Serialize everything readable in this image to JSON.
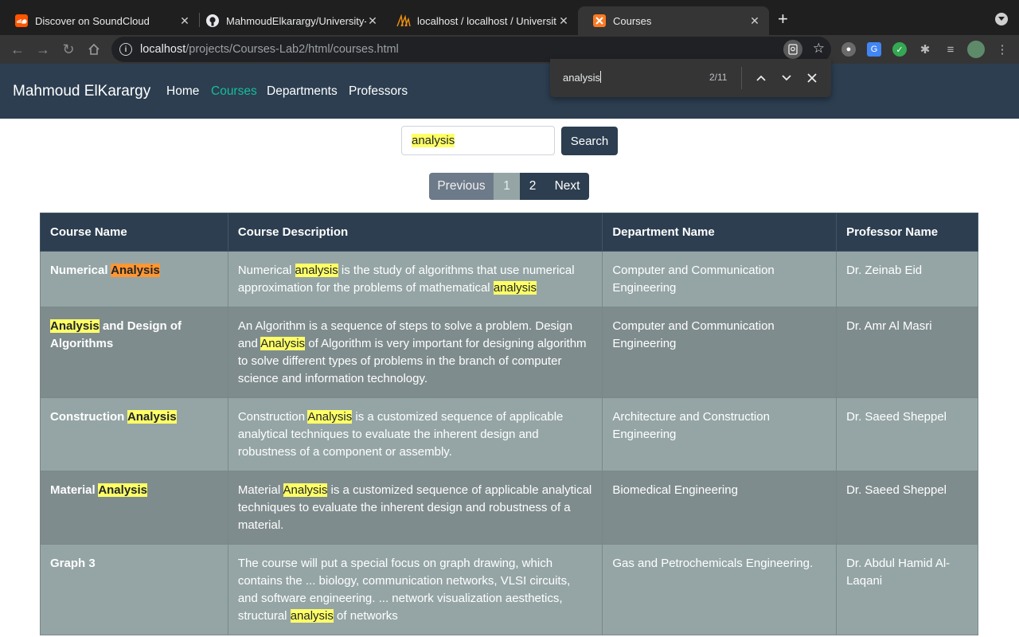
{
  "browser": {
    "tabs": [
      {
        "title": "Discover on SoundCloud",
        "icon": "soundcloud-icon"
      },
      {
        "title": "MahmoudElkarargy/University-",
        "icon": "github-icon"
      },
      {
        "title": "localhost / localhost / Universit",
        "icon": "phpmyadmin-icon"
      },
      {
        "title": "Courses",
        "icon": "xampp-icon"
      }
    ],
    "url_host": "localhost",
    "url_path": "/projects/Courses-Lab2/html/courses.html",
    "find": {
      "query": "analysis",
      "count": "2/11"
    }
  },
  "navbar": {
    "brand": "Mahmoud ElKarargy",
    "links": [
      "Home",
      "Courses",
      "Departments",
      "Professors"
    ],
    "active_color": "#18bc9c"
  },
  "search": {
    "value": "analysis",
    "button": "Search"
  },
  "pagination": [
    "Previous",
    "1",
    "2",
    "Next"
  ],
  "table": {
    "headers": [
      "Course Name",
      "Course Description",
      "Department Name",
      "Professor Name"
    ],
    "rows": [
      {
        "name": [
          "Numerical ",
          "Analysis",
          ""
        ],
        "desc": [
          "Numerical ",
          "analysis",
          " is the study of algorithms that use numerical approximation for the problems of mathematical ",
          "analysis",
          ""
        ],
        "dept": "Computer and Communication Engineering",
        "prof": "Dr. Zeinab Eid"
      },
      {
        "name": [
          "",
          "Analysis",
          " and Design of Algorithms"
        ],
        "desc": [
          "An Algorithm is a sequence of steps to solve a problem. Design and ",
          "Analysis",
          " of Algorithm is very important for designing algorithm to solve different types of problems in the branch of computer science and information technology.",
          "",
          ""
        ],
        "dept": "Computer and Communication Engineering",
        "prof": "Dr. Amr Al Masri"
      },
      {
        "name": [
          "Construction ",
          "Analysis",
          ""
        ],
        "desc": [
          "Construction ",
          "Analysis",
          " is a customized sequence of applicable analytical techniques to evaluate the inherent design and robustness of a component or assembly.",
          "",
          ""
        ],
        "dept": "Architecture and Construction Engineering",
        "prof": "Dr. Saeed Sheppel"
      },
      {
        "name": [
          "Material ",
          "Analysis",
          ""
        ],
        "desc": [
          "Material ",
          "Analysis",
          " is a customized sequence of applicable analytical techniques to evaluate the inherent design and robustness of a material.",
          "",
          ""
        ],
        "dept": "Biomedical Engineering",
        "prof": "Dr. Saeed Sheppel"
      },
      {
        "name": [
          "Graph 3",
          "",
          ""
        ],
        "desc": [
          "The course will put a special focus on graph drawing, which contains the ... biology, communication networks, VLSI circuits, and software engineering. ... network visualization aesthetics, structural ",
          "analysis",
          " of networks",
          "",
          ""
        ],
        "dept": "Gas and Petrochemicals Engineering.",
        "prof": "Dr. Abdul Hamid Al-Laqani"
      }
    ]
  }
}
